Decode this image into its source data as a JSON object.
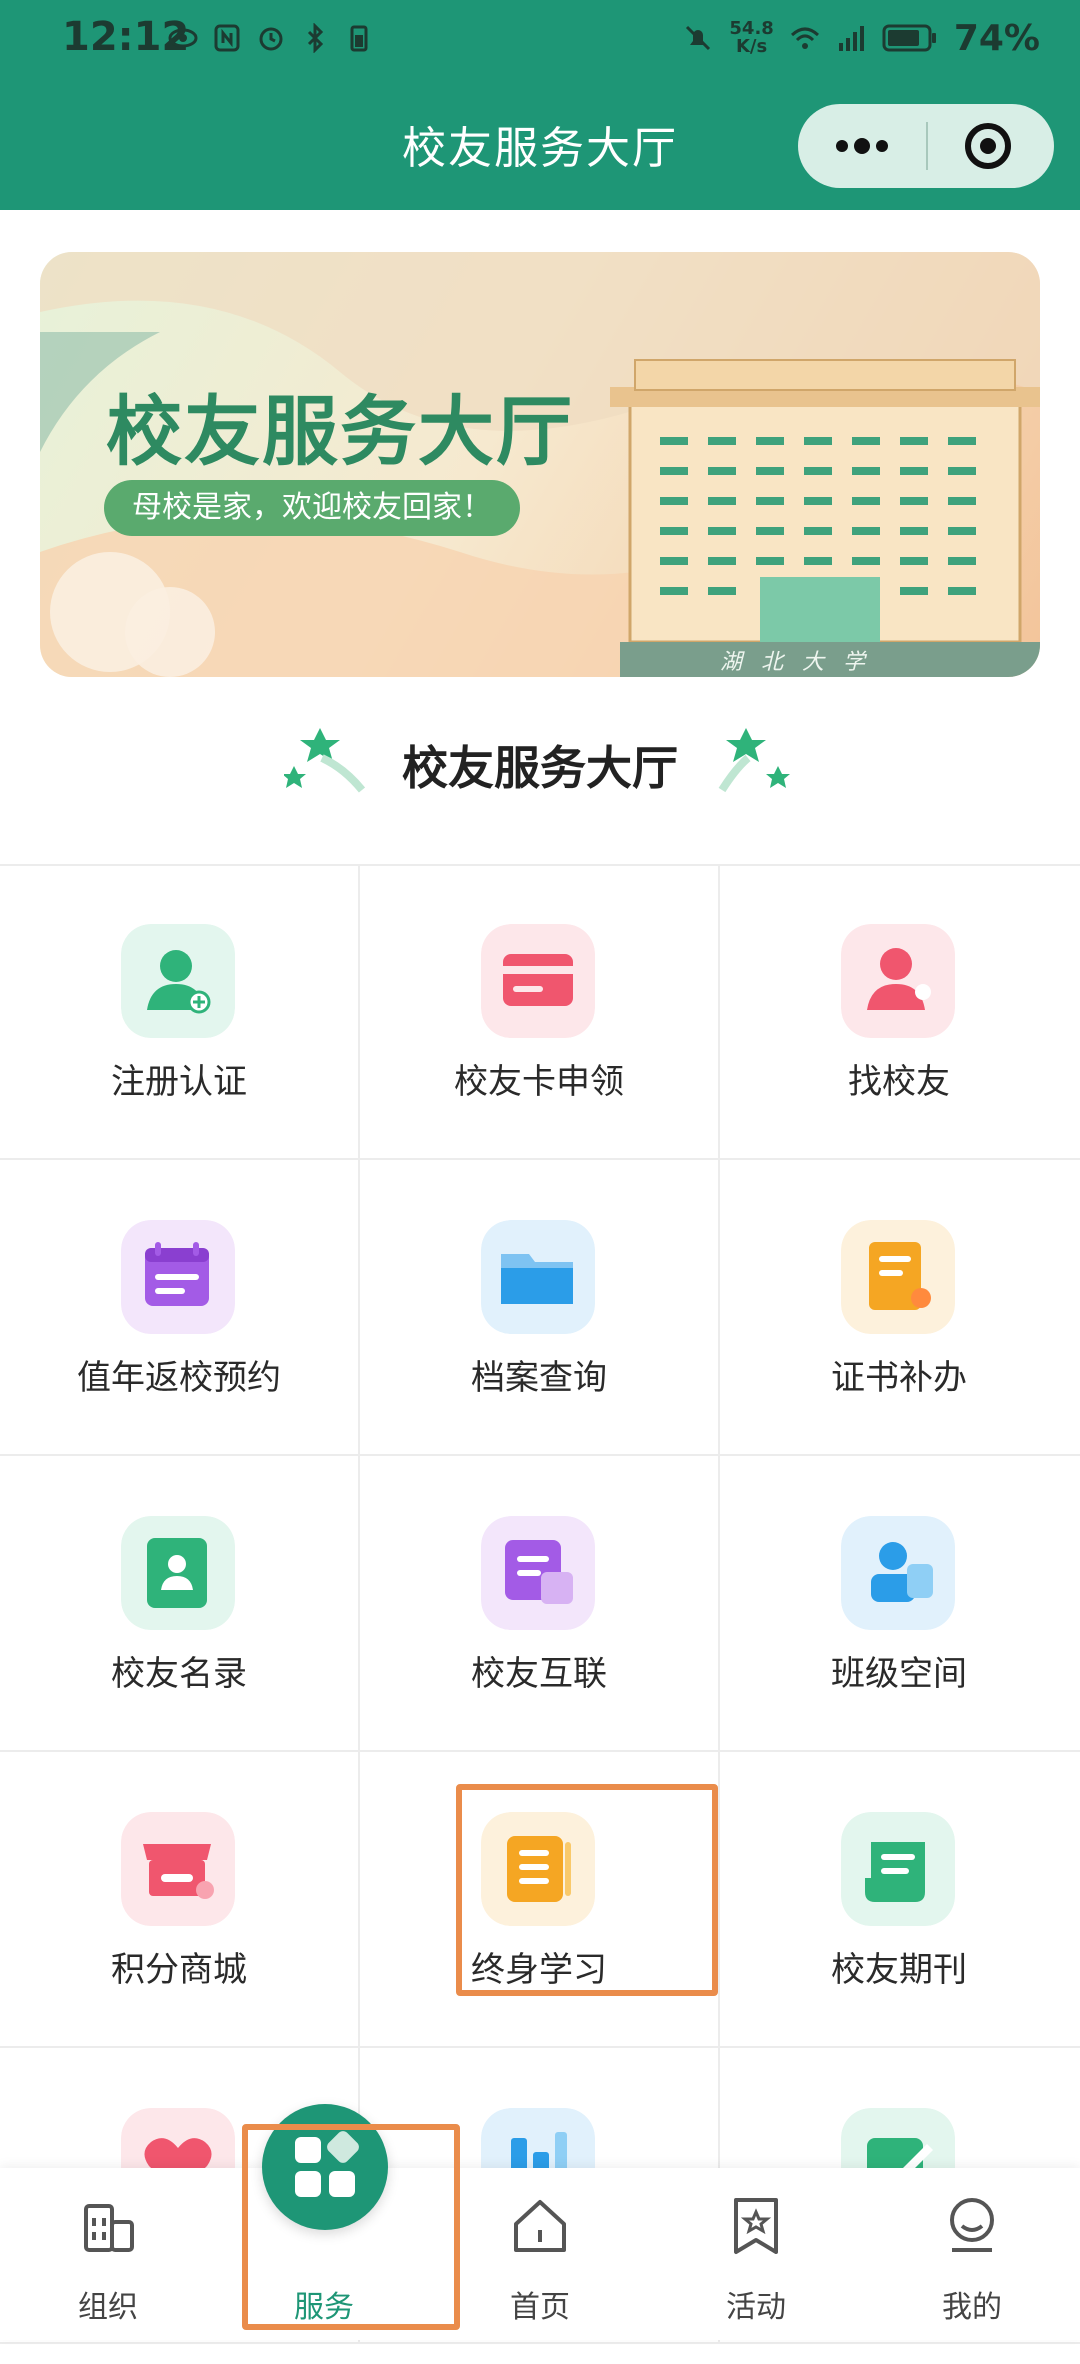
{
  "status_bar": {
    "time": "12:12",
    "net_speed_value": "54.8",
    "net_speed_unit": "K/s",
    "battery": "74%"
  },
  "header": {
    "title": "校友服务大厅"
  },
  "banner": {
    "title": "校友服务大厅",
    "subtitle": "母校是家，欢迎校友回家！",
    "building_caption": "湖 北 大 学"
  },
  "section": {
    "title": "校友服务大厅"
  },
  "services": [
    {
      "label": "注册认证",
      "icon": "user-add-icon",
      "color": "#2fb37a",
      "bg": "#e3f6ee"
    },
    {
      "label": "校友卡申领",
      "icon": "card-icon",
      "color": "#f0566e",
      "bg": "#fde7ea"
    },
    {
      "label": "找校友",
      "icon": "person-search-icon",
      "color": "#f0566e",
      "bg": "#fde7ea"
    },
    {
      "label": "值年返校预约",
      "icon": "calendar-icon",
      "color": "#a35be6",
      "bg": "#f3e6fb"
    },
    {
      "label": "档案查询",
      "icon": "folder-icon",
      "color": "#2b9de8",
      "bg": "#e1f1fc"
    },
    {
      "label": "证书补办",
      "icon": "certificate-icon",
      "color": "#f5a623",
      "bg": "#fdf1dc"
    },
    {
      "label": "校友名录",
      "icon": "directory-icon",
      "color": "#2fb37a",
      "bg": "#e3f6ee"
    },
    {
      "label": "校友互联",
      "icon": "message-icon",
      "color": "#a35be6",
      "bg": "#f3e6fb"
    },
    {
      "label": "班级空间",
      "icon": "class-icon",
      "color": "#2b9de8",
      "bg": "#e1f1fc"
    },
    {
      "label": "积分商城",
      "icon": "store-icon",
      "color": "#f0566e",
      "bg": "#fde7ea"
    },
    {
      "label": "终身学习",
      "icon": "book-icon",
      "color": "#f5a623",
      "bg": "#fdf1dc"
    },
    {
      "label": "校友期刊",
      "icon": "journal-icon",
      "color": "#2fb37a",
      "bg": "#e3f6ee"
    },
    {
      "label": "",
      "icon": "heart-icon",
      "color": "#f0566e",
      "bg": "#fde7ea"
    },
    {
      "label": "",
      "icon": "chart-icon",
      "color": "#2b9de8",
      "bg": "#e1f1fc"
    },
    {
      "label": "",
      "icon": "edit-icon",
      "color": "#2fb37a",
      "bg": "#e3f6ee"
    }
  ],
  "tabbar": {
    "items": [
      {
        "label": "组织",
        "icon": "building-icon"
      },
      {
        "label": "服务",
        "icon": "apps-icon"
      },
      {
        "label": "首页",
        "icon": "home-icon"
      },
      {
        "label": "活动",
        "icon": "badge-star-icon"
      },
      {
        "label": "我的",
        "icon": "profile-icon"
      }
    ]
  },
  "colors": {
    "primary": "#1e9676",
    "highlight": "#ea8c4b"
  }
}
